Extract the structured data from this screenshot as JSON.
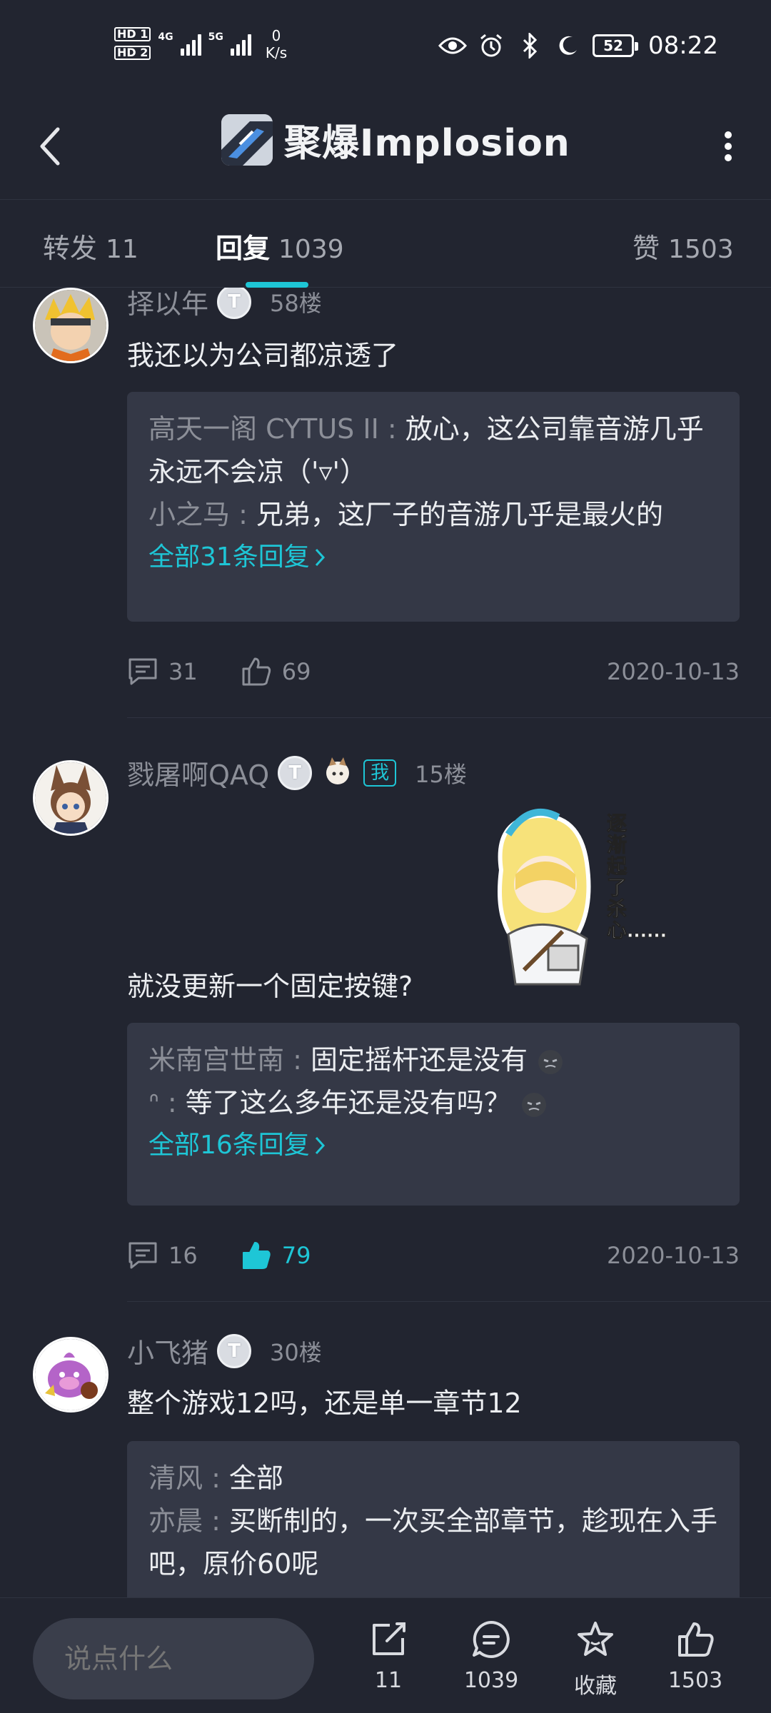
{
  "status_bar": {
    "hd1": "HD 1",
    "hd2": "HD 2",
    "net1": "4G",
    "net2": "5G",
    "speed_value": "0",
    "speed_unit": "K/s",
    "battery": "52",
    "time": "08:22"
  },
  "header": {
    "title": "聚爆Implosion"
  },
  "tabs": [
    {
      "label": "转发",
      "count": "11"
    },
    {
      "label": "回复",
      "count": "1039"
    },
    {
      "label": "赞",
      "count": "1503"
    }
  ],
  "comments": [
    {
      "username": "择以年",
      "level": "T",
      "floor": "58楼",
      "text": "我还以为公司都凉透了",
      "replies": [
        {
          "name": "高天一阁 CYTUS II",
          "text": "放心，这公司靠音游几乎永远不会凉（'▿'）"
        },
        {
          "name": "小之马",
          "text": "兄弟，这厂子的音游几乎是最火的"
        }
      ],
      "more_replies": "全部31条回复",
      "reply_count": "31",
      "like_count": "69",
      "date": "2020-10-13"
    },
    {
      "username": "戮屠啊QAQ",
      "level": "T",
      "me_tag": "我",
      "floor": "15楼",
      "text": "就没更新一个固定按键?",
      "sticker_text": "逐渐起了杀心……",
      "replies": [
        {
          "name": "米南宫世南",
          "text": "固定摇杆还是没有"
        },
        {
          "name": "ᐢ",
          "text": "等了这么多年还是没有吗？"
        }
      ],
      "more_replies": "全部16条回复",
      "reply_count": "16",
      "like_count": "79",
      "date": "2020-10-13"
    },
    {
      "username": "小飞猪",
      "level": "T",
      "floor": "30楼",
      "text": "整个游戏12吗，还是单一章节12",
      "replies": [
        {
          "name": "清风",
          "text": "全部"
        },
        {
          "name": "亦晨",
          "text": "买断制的，一次买全部章节，趁现在入手吧，原价60呢"
        }
      ]
    }
  ],
  "bottom_bar": {
    "input_placeholder": "说点什么",
    "share_count": "11",
    "comment_count": "1039",
    "favorite_label": "收藏",
    "like_count": "1503"
  }
}
